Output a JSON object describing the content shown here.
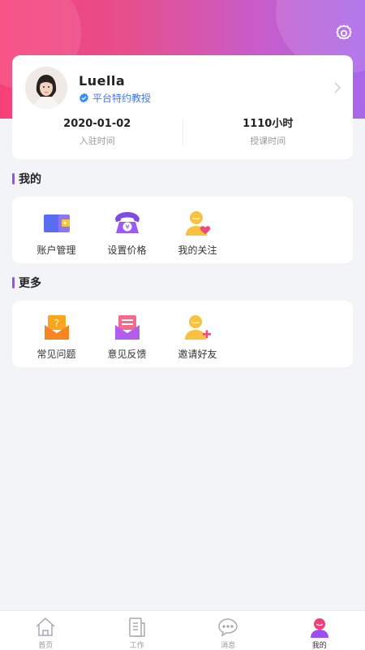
{
  "profile": {
    "name": "Luella",
    "badge": "平台特约教授",
    "stats": [
      {
        "value": "2020-01-02",
        "label": "入驻时间"
      },
      {
        "value": "1110小时",
        "label": "授课时间"
      }
    ]
  },
  "sections": {
    "mine": {
      "title": "我的",
      "items": [
        {
          "label": "账户管理",
          "icon": "wallet-icon"
        },
        {
          "label": "设置价格",
          "icon": "price-phone-icon"
        },
        {
          "label": "我的关注",
          "icon": "follow-heart-icon"
        }
      ]
    },
    "more": {
      "title": "更多",
      "items": [
        {
          "label": "常见问题",
          "icon": "faq-envelope-icon"
        },
        {
          "label": "意见反馈",
          "icon": "feedback-envelope-icon"
        },
        {
          "label": "邀请好友",
          "icon": "invite-friend-icon"
        }
      ]
    }
  },
  "tabbar": [
    {
      "label": "首页",
      "icon": "home-icon"
    },
    {
      "label": "工作",
      "icon": "work-icon"
    },
    {
      "label": "消息",
      "icon": "message-icon"
    },
    {
      "label": "我的",
      "icon": "profile-icon",
      "active": true
    }
  ],
  "colors": {
    "accent": "#9a4ff2",
    "gradient_start": "#f7407a",
    "gradient_end": "#a867ea",
    "badge": "#3579ff"
  }
}
